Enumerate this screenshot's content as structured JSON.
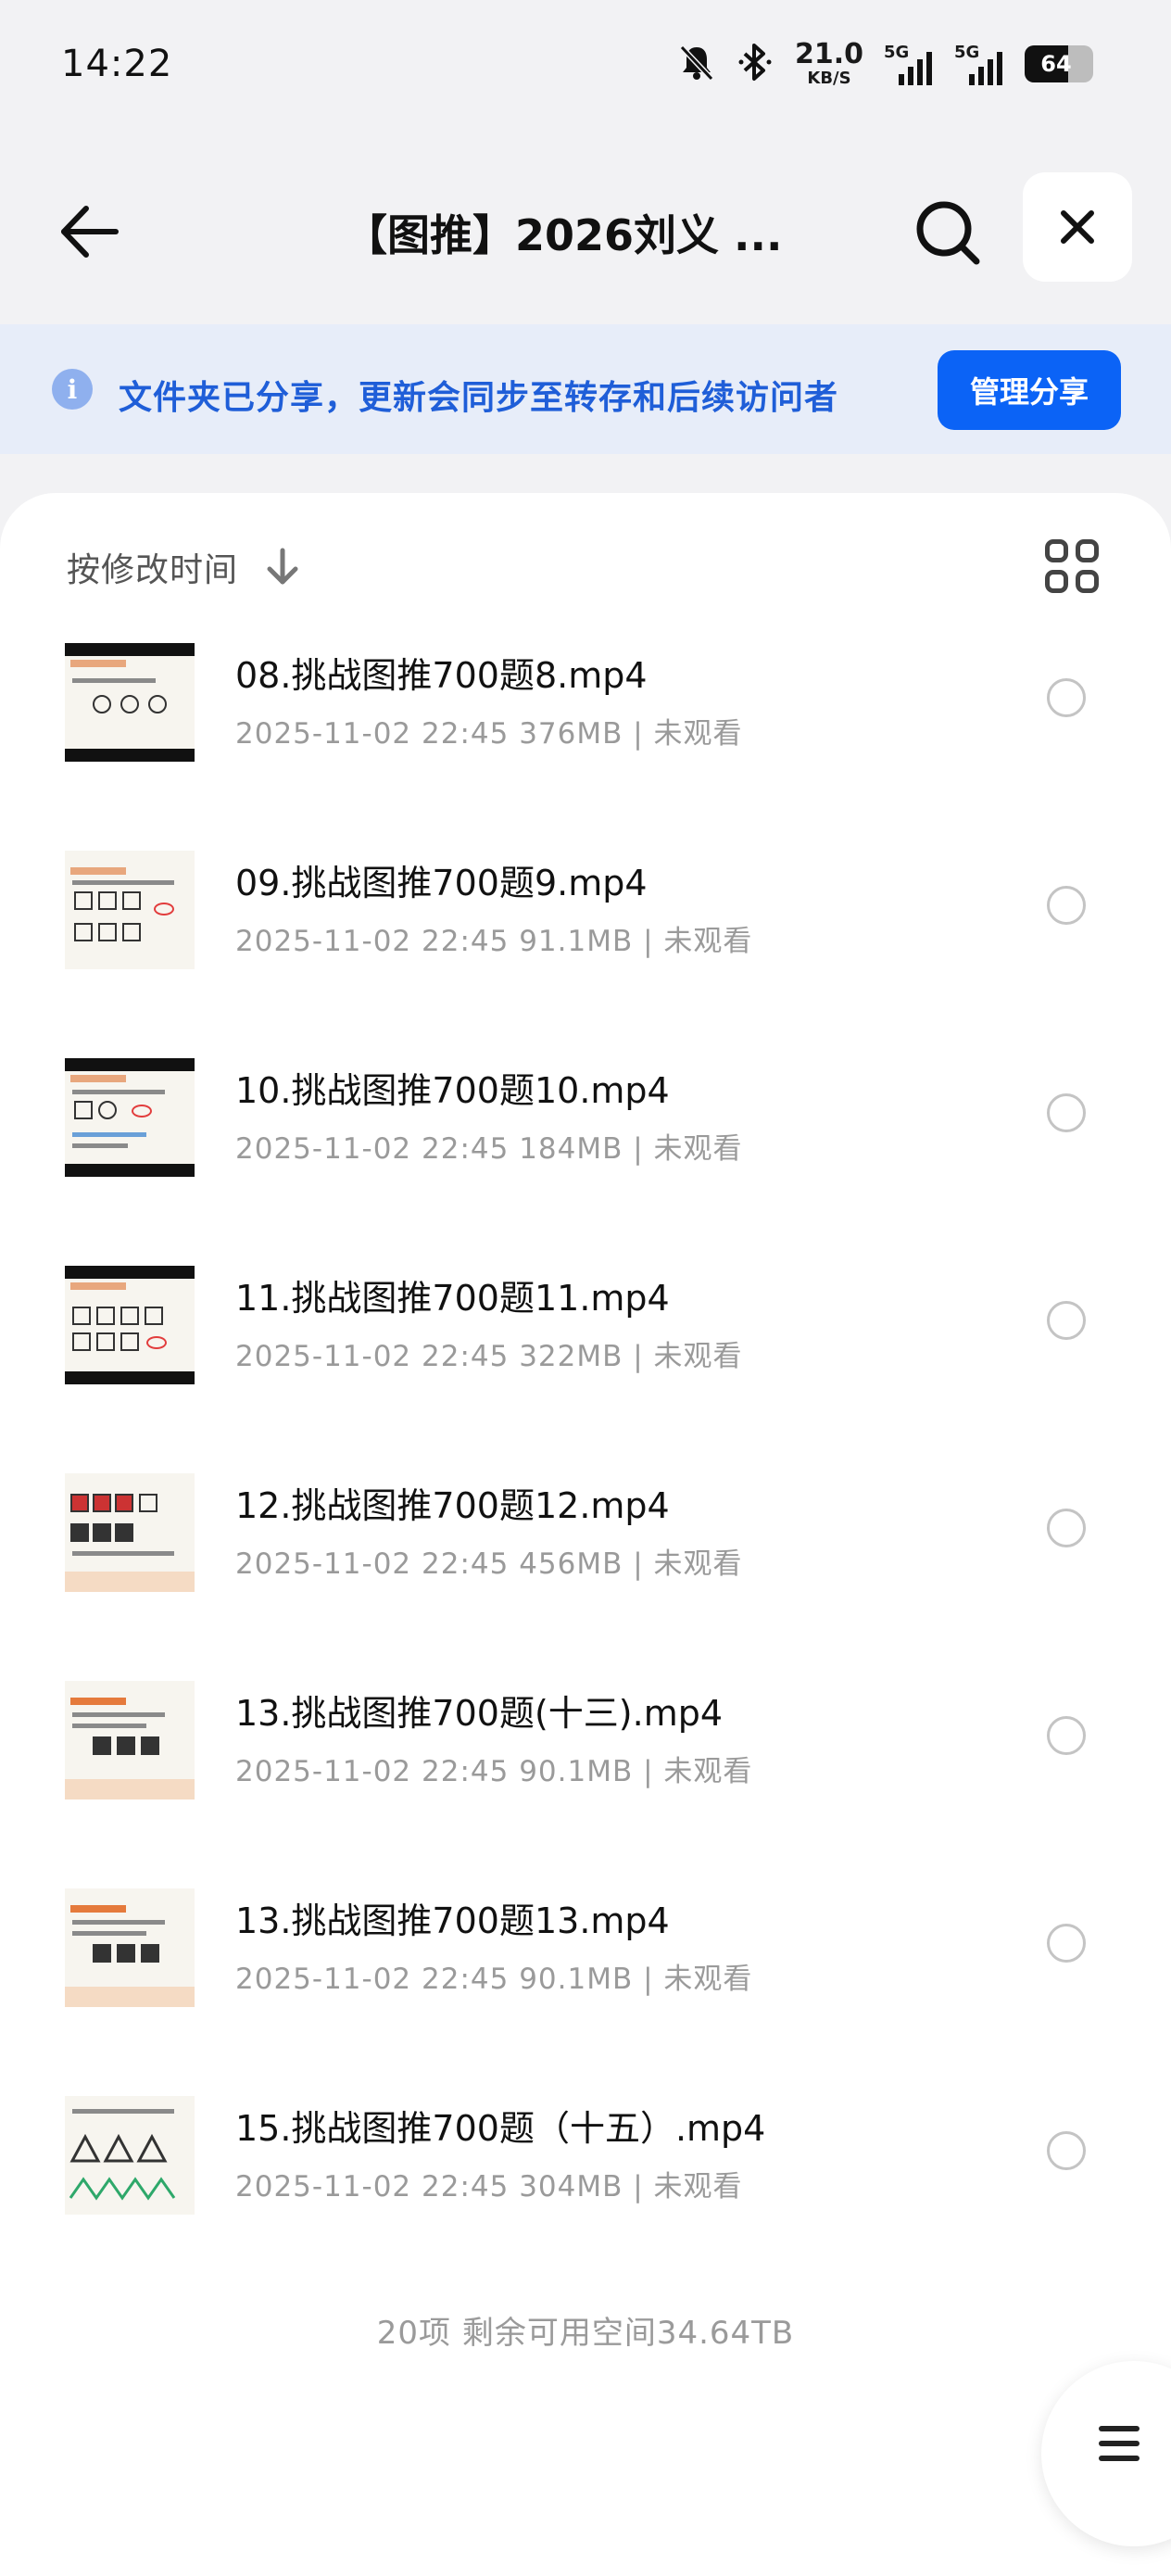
{
  "status_bar": {
    "time": "14:22",
    "net_speed": "21.0",
    "net_unit": "KB/S",
    "sim1_tag": "5G",
    "sim2_tag": "5G",
    "battery": "64",
    "battery_level": 0.64
  },
  "header": {
    "title": "【图推】2026刘义 ...",
    "back_icon": "arrow-left-icon",
    "search_icon": "search-icon",
    "close_icon": "close-icon"
  },
  "banner": {
    "message": "文件夹已分享，更新会同步至转存和后续访问者",
    "manage_button": "管理分享",
    "accent_color": "#0b63f6"
  },
  "sort": {
    "label": "按修改时间",
    "direction_icon": "arrow-down-icon",
    "view_toggle_icon": "grid-view-icon"
  },
  "files": [
    {
      "name": "08.挑战图推700题8.mp4",
      "meta": "2025-11-02 22:45  376MB | 未观看"
    },
    {
      "name": "09.挑战图推700题9.mp4",
      "meta": "2025-11-02 22:45  91.1MB | 未观看"
    },
    {
      "name": "10.挑战图推700题10.mp4",
      "meta": "2025-11-02 22:45  184MB | 未观看"
    },
    {
      "name": "11.挑战图推700题11.mp4",
      "meta": "2025-11-02 22:45  322MB | 未观看"
    },
    {
      "name": "12.挑战图推700题12.mp4",
      "meta": "2025-11-02 22:45  456MB | 未观看"
    },
    {
      "name": "13.挑战图推700题(十三).mp4",
      "meta": "2025-11-02 22:45  90.1MB | 未观看"
    },
    {
      "name": "13.挑战图推700题13.mp4",
      "meta": "2025-11-02 22:45  90.1MB | 未观看"
    },
    {
      "name": "15.挑战图推700题（十五）.mp4",
      "meta": "2025-11-02 22:45  304MB | 未观看"
    }
  ],
  "footer": {
    "summary": "20项 剩余可用空间34.64TB"
  },
  "fab": {
    "icon": "menu-icon"
  }
}
